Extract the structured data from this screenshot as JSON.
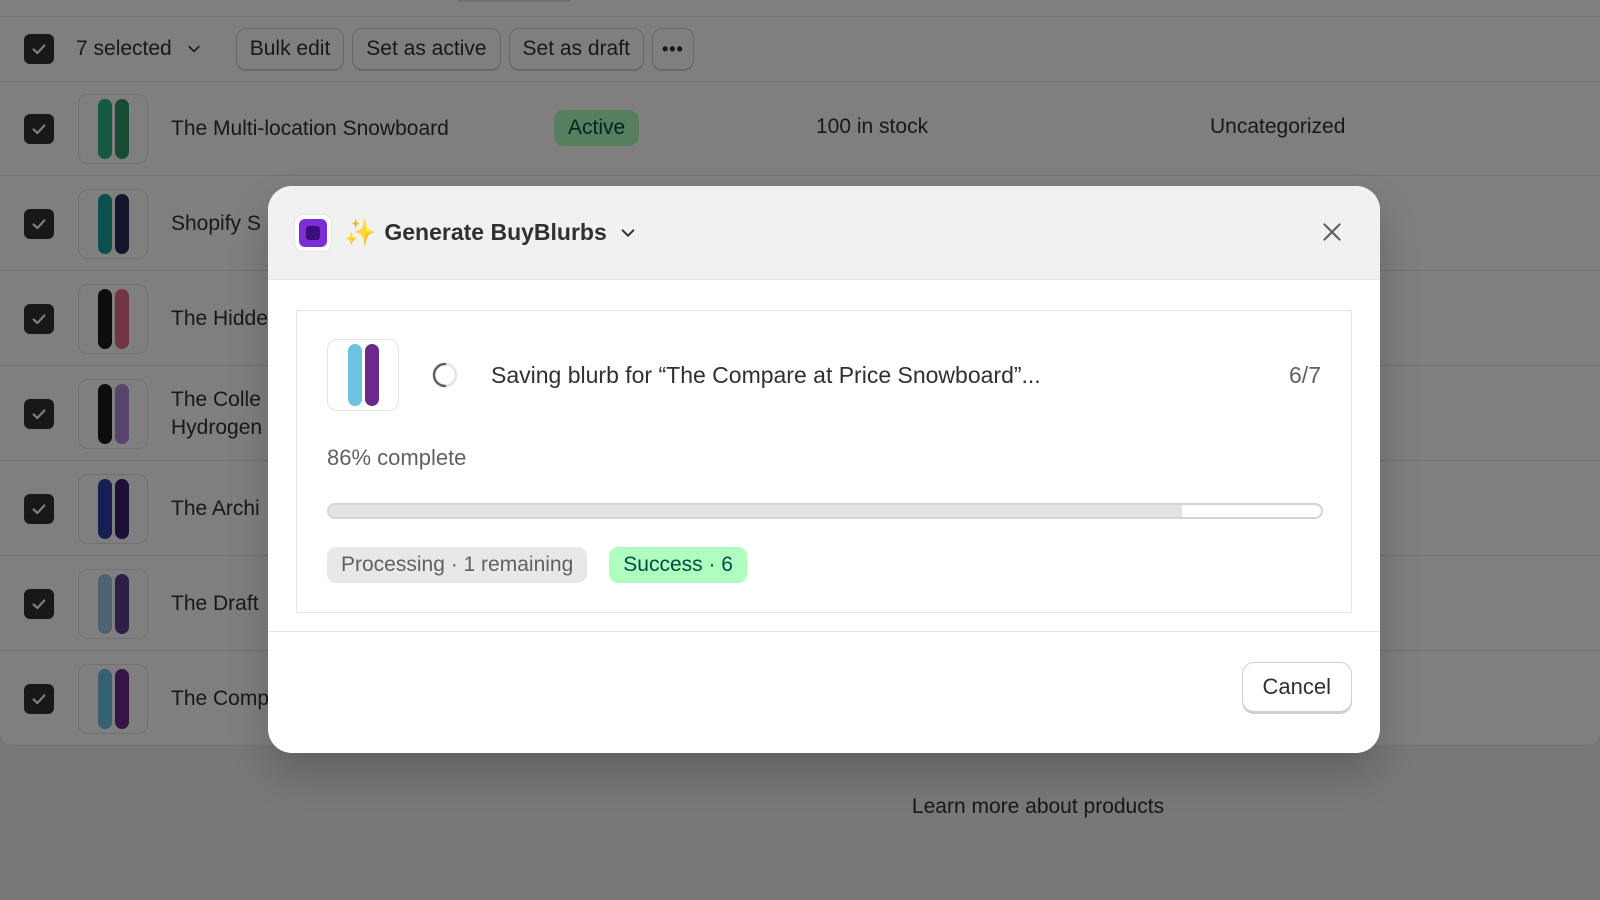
{
  "bulk_bar": {
    "selected_label": "7 selected",
    "bulk_edit": "Bulk edit",
    "set_active": "Set as active",
    "set_draft": "Set as draft",
    "more": "•••"
  },
  "rows": [
    {
      "title": "The Multi-location Snowboard",
      "status": "Active",
      "inventory": "100 in stock",
      "category": "Uncategorized",
      "colors": [
        "#2fb383",
        "#2e9a6a"
      ]
    },
    {
      "title": "Shopify S",
      "colors": [
        "#1ba39b",
        "#2a2d5c"
      ]
    },
    {
      "title": "The Hidde",
      "colors": [
        "#1a1a1a",
        "#e46a8a"
      ]
    },
    {
      "title": "The Colle",
      "title2": "Hydrogen",
      "colors": [
        "#1a1a1a",
        "#b18ad6"
      ]
    },
    {
      "title": "The Archi",
      "colors": [
        "#2c3da8",
        "#3a1f6b"
      ]
    },
    {
      "title": "The Draft",
      "colors": [
        "#9cc5e8",
        "#5b3d8f"
      ]
    },
    {
      "title": "The Comp",
      "colors": [
        "#6cc3e0",
        "#6b2a8a"
      ]
    }
  ],
  "learn_more": "Learn more about products",
  "modal": {
    "title": "Generate BuyBlurbs",
    "sparkle": "✨",
    "status_text": "Saving blurb for “The Compare at Price Snowboard”...",
    "count": "6/7",
    "percent_label": "86% complete",
    "progress": 0.86,
    "processing_tag": "Processing · 1 remaining",
    "success_tag": "Success · 6",
    "cancel": "Cancel"
  },
  "colors": {
    "overlay": "rgba(0,0,0,0.5)",
    "success_bg": "#affebf",
    "brand_purple": "#7b2ed6"
  },
  "icons": [
    "checkbox-checked-icon",
    "chevron-down-icon",
    "sparkle-icon",
    "close-icon",
    "spinner-icon",
    "app-logo-icon"
  ]
}
